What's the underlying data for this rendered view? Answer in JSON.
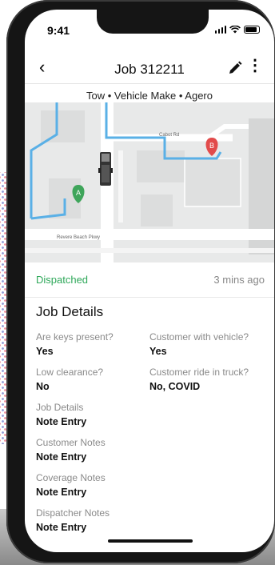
{
  "status_bar": {
    "time": "9:41"
  },
  "header": {
    "title": "Job 312211",
    "subtitle": "Tow • Vehicle Make • Agero"
  },
  "map": {
    "street_top": "Cabot Rd",
    "street_bottom": "Revere Beach Pkwy",
    "pin_a": "A",
    "pin_b": "B"
  },
  "status": {
    "label": "Dispatched",
    "time_ago": "3 mins ago",
    "color": "#2fa85a"
  },
  "job_details": {
    "heading": "Job Details",
    "pairs": [
      {
        "label": "Are keys present?",
        "value": "Yes"
      },
      {
        "label": "Customer with vehicle?",
        "value": "Yes"
      },
      {
        "label": "Low clearance?",
        "value": "No"
      },
      {
        "label": "Customer ride in truck?",
        "value": "No, COVID"
      }
    ],
    "notes": [
      {
        "label": "Job Details",
        "value": "Note Entry"
      },
      {
        "label": "Customer Notes",
        "value": "Note Entry"
      },
      {
        "label": "Coverage Notes",
        "value": "Note Entry"
      },
      {
        "label": "Dispatcher Notes",
        "value": "Note Entry"
      }
    ]
  }
}
